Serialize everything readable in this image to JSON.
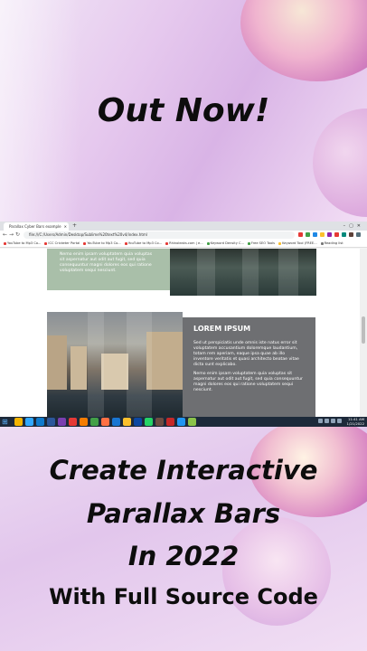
{
  "heading_top": "Out Now!",
  "heading_bottom": {
    "line1": "Create Interactive",
    "line2": "Parallax Bars",
    "line3": "In 2022",
    "line4": "With Full Source Code"
  },
  "browser": {
    "tab_title": "Parallax Cyber Bars example",
    "url": "file:///C:/Users/Admin/Desktop/Sublime%20text%20v4/index.html",
    "bookmarks": [
      "YouTube to Mp3 Co...",
      "ICC Cricketer Portal",
      "YouTube to Mp3 Co...",
      "YouTube to Mp3 Co...",
      "Rhinoleaks.com | e...",
      "Keyword Density C...",
      "Free SEO Tools",
      "Keyword Tool (FREE...",
      "Reading list"
    ]
  },
  "page": {
    "card1_text": "Nemo enim ipsam voluptatem quia voluptas sit aspernatur aut odit aut fugit, sed quia consequuntur magni dolores eos qui ratione voluptatem sequi nesciunt.",
    "card2_title": "LOREM IPSUM",
    "card2_p1": "Sed ut perspiciatis unde omnis iste natus error sit voluptatem accusantium doloremque laudantium, totam rem aperiam, eaque ipsa quae ab illo inventore veritatis et quasi architecto beatae vitae dicta sunt explicabo.",
    "card2_p2": "Nemo enim ipsam voluptatem quia voluptas sit aspernatur aut odit aut fugit, sed quia consequuntur magni dolores eos qui ratione voluptatem sequi nesciunt."
  },
  "taskbar": {
    "time": "11:41 AM",
    "date": "1/21/2022"
  }
}
